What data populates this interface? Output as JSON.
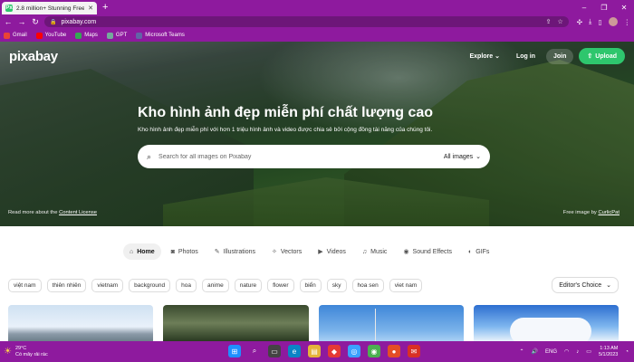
{
  "browser": {
    "tab_title": "2.8 million+ Stunning Free Imag",
    "tab_favicon": "Px",
    "new_tab": "+",
    "url": "pixabay.com",
    "window_controls": [
      "–",
      "❐",
      "✕"
    ],
    "bookmarks": [
      {
        "label": "Gmail",
        "color": "#ea4335"
      },
      {
        "label": "YouTube",
        "color": "#ff0000"
      },
      {
        "label": "Maps",
        "color": "#34a853"
      },
      {
        "label": "GPT",
        "color": "#74aa9c"
      },
      {
        "label": "Microsoft Teams",
        "color": "#6264a7"
      }
    ]
  },
  "site": {
    "logo": "pixabay",
    "nav": {
      "explore": "Explore",
      "login": "Log in",
      "join": "Join",
      "upload": "Upload"
    },
    "hero": {
      "title": "Kho hình ảnh đẹp miễn phí chất lượng cao",
      "subtitle": "Kho hình ảnh đẹp miễn phí với hơn 1 triệu hình ảnh và video được chia sẻ bởi cộng đồng tài năng của chúng tôi.",
      "search_placeholder": "Search for all images on Pixabay",
      "search_filter": "All images",
      "license_prefix": "Read more about the",
      "license_link": "Content License",
      "credit_prefix": "Free image by",
      "credit_link": "CurlicPat"
    },
    "categories": [
      {
        "label": "Home",
        "icon": "⌂",
        "active": true
      },
      {
        "label": "Photos",
        "icon": "◙",
        "active": false
      },
      {
        "label": "Illustrations",
        "icon": "✎",
        "active": false
      },
      {
        "label": "Vectors",
        "icon": "✧",
        "active": false
      },
      {
        "label": "Videos",
        "icon": "▶",
        "active": false
      },
      {
        "label": "Music",
        "icon": "♫",
        "active": false
      },
      {
        "label": "Sound Effects",
        "icon": "◉",
        "active": false
      },
      {
        "label": "GIFs",
        "icon": "◐",
        "active": false
      }
    ],
    "tags": [
      "việt nam",
      "thiên nhiên",
      "vietnam",
      "background",
      "hoa",
      "anime",
      "nature",
      "flower",
      "biển",
      "sky",
      "hoa sen",
      "viet nam"
    ],
    "sort": "Editor's Choice"
  },
  "taskbar": {
    "temperature": "29°C",
    "weather_desc": "Có mây rải rác",
    "language": "ENG",
    "time": "1:13 AM",
    "date": "5/1/2023",
    "apps": [
      {
        "icon": "⊞",
        "color": "#1e90ff"
      },
      {
        "icon": "⌕",
        "color": "transparent"
      },
      {
        "icon": "▭",
        "color": "#444"
      },
      {
        "icon": "e",
        "color": "#0a84c6"
      },
      {
        "icon": "▤",
        "color": "#e5b33a"
      },
      {
        "icon": "◆",
        "color": "#e53935"
      },
      {
        "icon": "◎",
        "color": "#3aa0ff"
      },
      {
        "icon": "◉",
        "color": "#4caf50"
      },
      {
        "icon": "●",
        "color": "#e44d26"
      },
      {
        "icon": "✉",
        "color": "#d93025"
      }
    ]
  }
}
